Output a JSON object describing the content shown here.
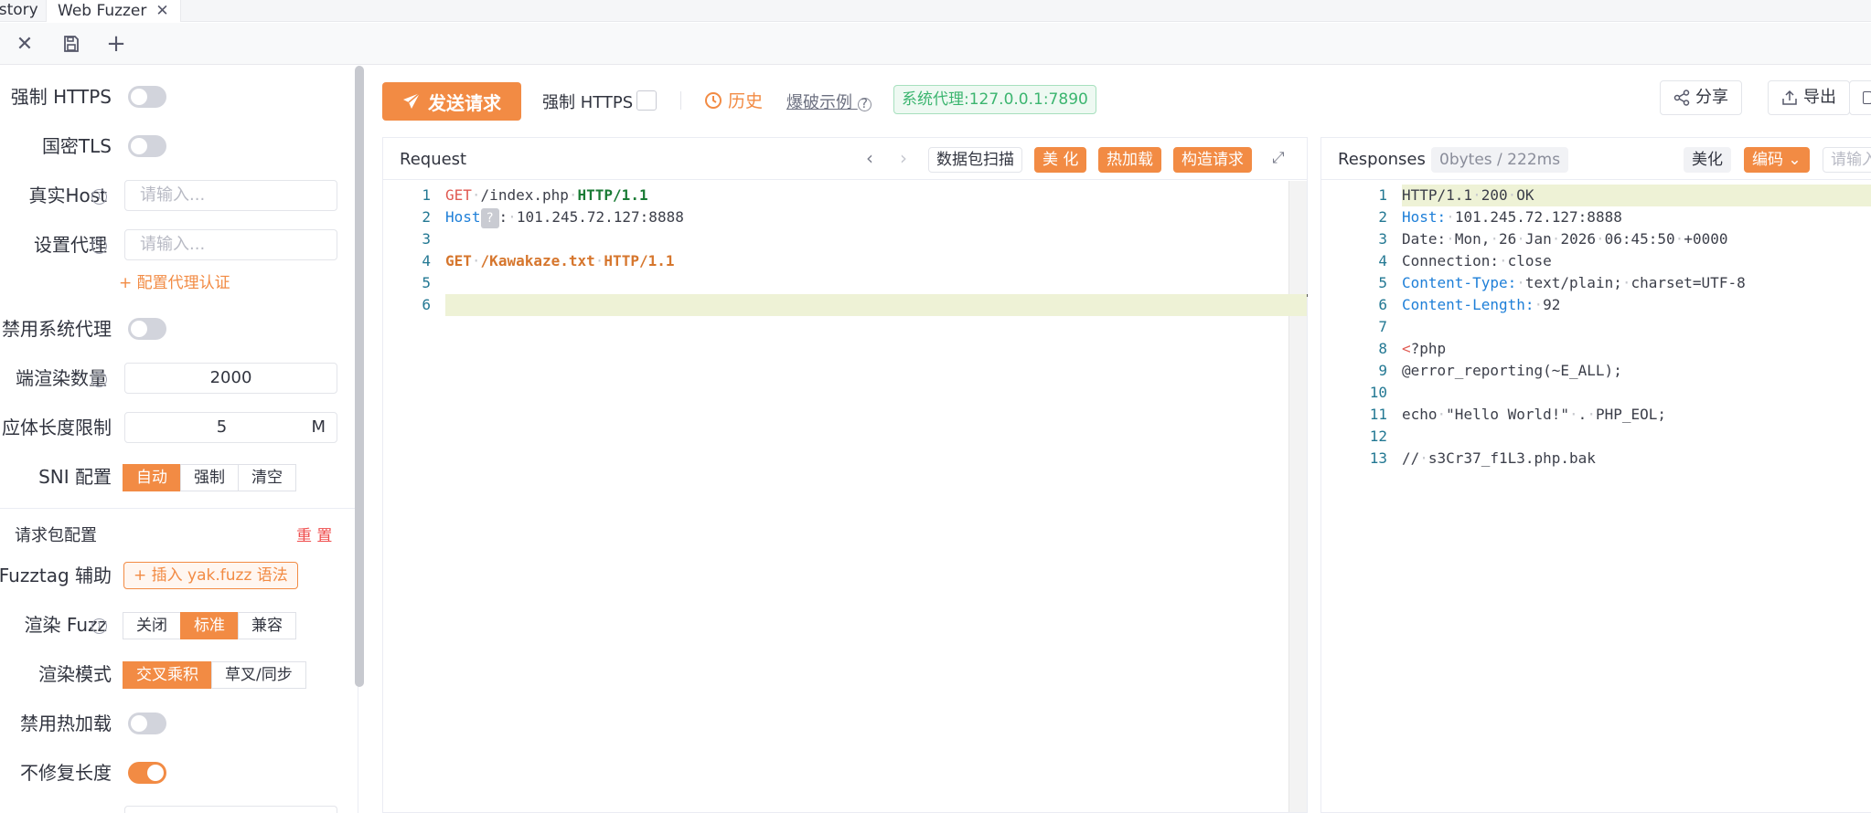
{
  "tabs": [
    {
      "label": "istory"
    },
    {
      "label": "Web Fuzzer"
    }
  ],
  "sidebar": {
    "force_https_label": "强制 HTTPS",
    "gm_tls_label": "国密TLS",
    "real_host_label": "真实Host",
    "real_host_placeholder": "请输入...",
    "proxy_label": "设置代理",
    "proxy_placeholder": "请输入...",
    "proxy_auth_link": "+ 配置代理认证",
    "disable_system_proxy_label": "禁用系统代理",
    "render_count_label": "端渲染数量",
    "render_count_value": "2000",
    "body_limit_label": "应体长度限制",
    "body_limit_value": "5",
    "body_limit_unit": "M",
    "sni_label": "SNI 配置",
    "sni_options": [
      "自动",
      "强制",
      "清空"
    ],
    "sni_selected": "自动",
    "packet_config_title": "请求包配置",
    "reset_label": "重 置",
    "fuzztag_label": "Fuzztag 辅助",
    "fuzztag_button": "+ 插入 yak.fuzz 语法",
    "render_fuzz_label": "渲染 Fuzz",
    "render_fuzz_options": [
      "关闭",
      "标准",
      "兼容"
    ],
    "render_fuzz_selected": "标准",
    "render_mode_label": "渲染模式",
    "render_mode_options": [
      "交叉乘积",
      "草叉/同步"
    ],
    "render_mode_selected": "交叉乘积",
    "disable_hotload_label": "禁用热加载",
    "no_fix_length_label": "不修复长度"
  },
  "toolbar": {
    "send_label": "发送请求",
    "force_https_label": "强制 HTTPS",
    "history_label": "历史",
    "example_label": "爆破示例",
    "proxy_tag": "系统代理:127.0.0.1:7890",
    "share_label": "分享",
    "export_label": "导出"
  },
  "request": {
    "title": "Request",
    "scan_label": "数据包扫描",
    "beautify_label": "美 化",
    "hotload_label": "热加载",
    "build_label": "构造请求"
  },
  "response": {
    "title": "Responses",
    "stats": "0bytes / 222ms",
    "beautify_label": "美化",
    "encode_label": "编码",
    "search_placeholder": "请输入"
  },
  "request_lines": [
    {
      "n": "1",
      "parts": [
        [
          "k-red",
          "GET"
        ],
        [
          "dot",
          "·"
        ],
        [
          "k-dark",
          "/index.php"
        ],
        [
          "dot",
          "·"
        ],
        [
          "k-green",
          "HTTP/1.1"
        ]
      ]
    },
    {
      "n": "2",
      "parts": [
        [
          "k-blue",
          "Host"
        ],
        [
          "q",
          "?"
        ],
        [
          "k-dark",
          ":"
        ],
        [
          "dot",
          "·"
        ],
        [
          "k-dark",
          "101.245.72.127:8888"
        ]
      ]
    },
    {
      "n": "3",
      "parts": []
    },
    {
      "n": "4",
      "parts": [
        [
          "k-orange",
          "GET"
        ],
        [
          "dot",
          "·"
        ],
        [
          "k-orange",
          "/Kawakaze.txt"
        ],
        [
          "dot",
          "·"
        ],
        [
          "k-orange",
          "HTTP/1.1"
        ]
      ]
    },
    {
      "n": "5",
      "parts": []
    },
    {
      "n": "6",
      "parts": []
    }
  ],
  "response_lines": [
    {
      "n": "1",
      "parts": [
        [
          "k-dark",
          "HTTP/1.1"
        ],
        [
          "dot",
          "·"
        ],
        [
          "k-dark",
          "200"
        ],
        [
          "dot",
          "·"
        ],
        [
          "k-dark",
          "OK"
        ]
      ]
    },
    {
      "n": "2",
      "parts": [
        [
          "k-blue",
          "Host:"
        ],
        [
          "dot",
          "·"
        ],
        [
          "k-dark",
          "101.245.72.127:8888"
        ]
      ]
    },
    {
      "n": "3",
      "parts": [
        [
          "k-dark",
          "Date:"
        ],
        [
          "dot",
          "·"
        ],
        [
          "k-dark",
          "Mon,"
        ],
        [
          "dot",
          "·"
        ],
        [
          "k-dark",
          "26"
        ],
        [
          "dot",
          "·"
        ],
        [
          "k-dark",
          "Jan"
        ],
        [
          "dot",
          "·"
        ],
        [
          "k-dark",
          "2026"
        ],
        [
          "dot",
          "·"
        ],
        [
          "k-dark",
          "06:45:50"
        ],
        [
          "dot",
          "·"
        ],
        [
          "k-dark",
          "+0000"
        ]
      ]
    },
    {
      "n": "4",
      "parts": [
        [
          "k-dark",
          "Connection:"
        ],
        [
          "dot",
          "·"
        ],
        [
          "k-dark",
          "close"
        ]
      ]
    },
    {
      "n": "5",
      "parts": [
        [
          "k-blue",
          "Content-Type:"
        ],
        [
          "dot",
          "·"
        ],
        [
          "k-dark",
          "text/plain;"
        ],
        [
          "dot",
          "·"
        ],
        [
          "k-dark",
          "charset=UTF-8"
        ]
      ]
    },
    {
      "n": "6",
      "parts": [
        [
          "k-blue",
          "Content-Length:"
        ],
        [
          "dot",
          "·"
        ],
        [
          "k-dark",
          "92"
        ]
      ]
    },
    {
      "n": "7",
      "parts": []
    },
    {
      "n": "8",
      "parts": [
        [
          "k-red",
          "<"
        ],
        [
          "k-dark",
          "?php"
        ]
      ]
    },
    {
      "n": "9",
      "parts": [
        [
          "k-dark",
          "@error_reporting(~E_ALL);"
        ]
      ]
    },
    {
      "n": "10",
      "parts": []
    },
    {
      "n": "11",
      "parts": [
        [
          "k-dark",
          "echo"
        ],
        [
          "dot",
          "·"
        ],
        [
          "k-dark",
          "\"Hello World!\""
        ],
        [
          "dot",
          "·"
        ],
        [
          "k-dark",
          "."
        ],
        [
          "dot",
          "·"
        ],
        [
          "k-dark",
          "PHP_EOL;"
        ]
      ]
    },
    {
      "n": "12",
      "parts": []
    },
    {
      "n": "13",
      "parts": [
        [
          "k-dark",
          "//"
        ],
        [
          "dot",
          "·"
        ],
        [
          "k-dark",
          "s3Cr37_f1L3.php.bak"
        ]
      ]
    }
  ],
  "colors": {
    "accent": "#f28b44",
    "proxy_green": "#3bb56f",
    "reset_red": "#ef4d4d"
  }
}
